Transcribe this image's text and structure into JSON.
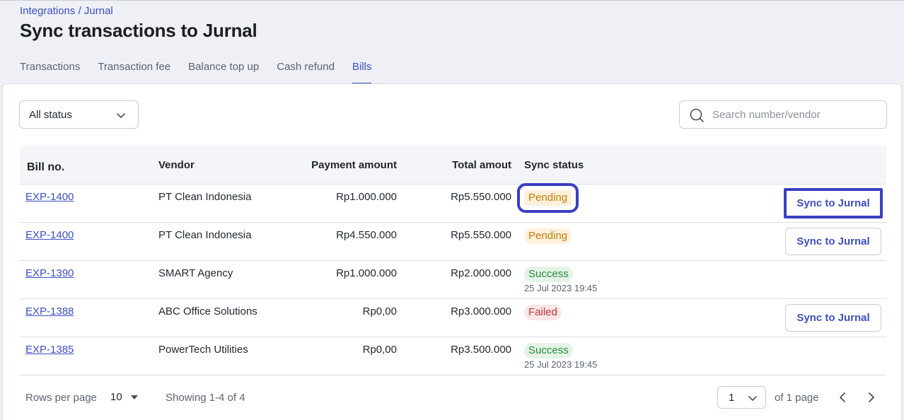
{
  "breadcrumb": {
    "parent": "Integrations",
    "separator": "/",
    "current": "Jurnal"
  },
  "page_title": "Sync transactions to Jurnal",
  "tabs": [
    {
      "label": "Transactions"
    },
    {
      "label": "Transaction fee"
    },
    {
      "label": "Balance top up"
    },
    {
      "label": "Cash refund"
    },
    {
      "label": "Bills",
      "active": true
    }
  ],
  "filter": {
    "status_value": "All status"
  },
  "search": {
    "placeholder": "Search number/vendor",
    "value": ""
  },
  "table": {
    "headers": {
      "bill_no": "Bill no.",
      "vendor": "Vendor",
      "payment_amount": "Payment amount",
      "total_amount": "Total amout",
      "sync_status": "Sync status"
    },
    "rows": [
      {
        "bill_no": "EXP-1400",
        "vendor": "PT Clean Indonesia",
        "payment_amount": "Rp1.000.000",
        "total_amount": "Rp5.550.000",
        "status": "Pending",
        "status_type": "pending",
        "synced_at": "",
        "action": "Sync to Jurnal",
        "highlight": true
      },
      {
        "bill_no": "EXP-1400",
        "vendor": "PT Clean Indonesia",
        "payment_amount": "Rp4.550.000",
        "total_amount": "Rp5.550.000",
        "status": "Pending",
        "status_type": "pending",
        "synced_at": "",
        "action": "Sync to Jurnal",
        "highlight": false
      },
      {
        "bill_no": "EXP-1390",
        "vendor": "SMART Agency",
        "payment_amount": "Rp1.000.000",
        "total_amount": "Rp2.000.000",
        "status": "Success",
        "status_type": "success",
        "synced_at": "25 Jul 2023 19:45",
        "action": "",
        "highlight": false
      },
      {
        "bill_no": "EXP-1388",
        "vendor": "ABC Office Solutions",
        "payment_amount": "Rp0,00",
        "total_amount": "Rp3.000.000",
        "status": "Failed",
        "status_type": "failed",
        "synced_at": "",
        "action": "Sync to Jurnal",
        "highlight": false
      },
      {
        "bill_no": "EXP-1385",
        "vendor": "PowerTech Utilities",
        "payment_amount": "Rp0,00",
        "total_amount": "Rp3.500.000",
        "status": "Success",
        "status_type": "success",
        "synced_at": "25 Jul 2023 19:45",
        "action": "",
        "highlight": false
      }
    ]
  },
  "pagination": {
    "rows_per_page_label": "Rows per page",
    "rows_per_page_value": "10",
    "showing": "Showing 1-4 of 4",
    "page_value": "1",
    "page_of": "of 1 page"
  },
  "colors": {
    "accent": "#3d4fc2",
    "highlight": "#3b3fc3",
    "pending": "#c77d0a",
    "success": "#2e8b3a",
    "failed": "#c2333b"
  },
  "icons": {
    "status_chevron": "chevron-down-icon",
    "search": "search-icon",
    "prev": "chevron-left-icon",
    "next": "chevron-right-icon",
    "rows_caret": "caret-down-icon"
  }
}
